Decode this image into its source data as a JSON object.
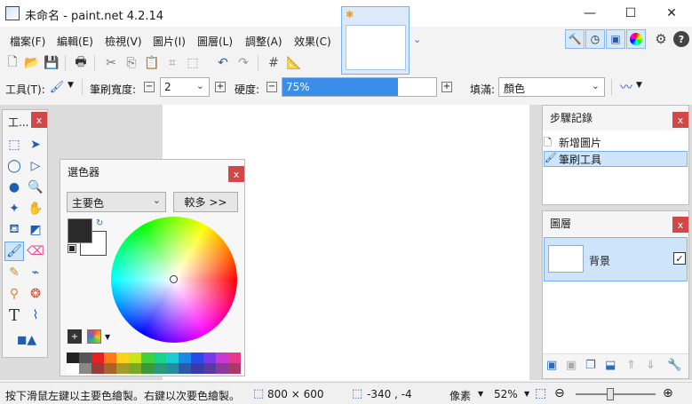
{
  "window": {
    "title": "未命名 - paint.net 4.2.14",
    "minimize": "—",
    "maximize": "☐",
    "close": "✕"
  },
  "menu": [
    "檔案(F)",
    "編輯(E)",
    "檢視(V)",
    "圖片(I)",
    "圖層(L)",
    "調整(A)",
    "效果(C)"
  ],
  "tab": {
    "star": "✱"
  },
  "toolbar2": {
    "tool_label": "工具(T):",
    "brush_width_label": "筆刷寬度:",
    "brush_width_value": "2",
    "hardness_label": "硬度:",
    "hardness_value": "75%",
    "hardness_fraction": 0.75,
    "fill_label": "填滿:",
    "fill_value": "顏色"
  },
  "tools_panel": {
    "title": "工...",
    "close": "x"
  },
  "colors_panel": {
    "title": "選色器",
    "close": "x",
    "mode_value": "主要色",
    "more_button": "較多 >>"
  },
  "history_panel": {
    "title": "步驟記錄",
    "close": "x",
    "items": [
      "新增圖片",
      "筆刷工具"
    ]
  },
  "layers_panel": {
    "title": "圖層",
    "close": "x",
    "layer_name": "背景",
    "checked": true
  },
  "status": {
    "hint": "按下滑鼠左鍵以主要色繪製。右鍵以次要色繪製。",
    "image_size": "800 × 600",
    "cursor_pos": "-340 , -4",
    "units": "像素",
    "zoom": "52%"
  },
  "palette": [
    "#222222",
    "#555555",
    "#e82020",
    "#ff7a1a",
    "#ffd21a",
    "#c8e61a",
    "#3fd23a",
    "#1ad28a",
    "#1acdd2",
    "#1a8ae8",
    "#2a4ae8",
    "#7a3ae8",
    "#c83ad2",
    "#e83a8a",
    "#ffffff",
    "#888888",
    "#9a3a3a",
    "#a8642a",
    "#a89a2a",
    "#7aa82a",
    "#3a9a3a",
    "#2a9a7a",
    "#2a8aa0",
    "#2a5aa8",
    "#3a3aa8",
    "#5a3aa0",
    "#8a3a9a",
    "#a83a6a"
  ]
}
